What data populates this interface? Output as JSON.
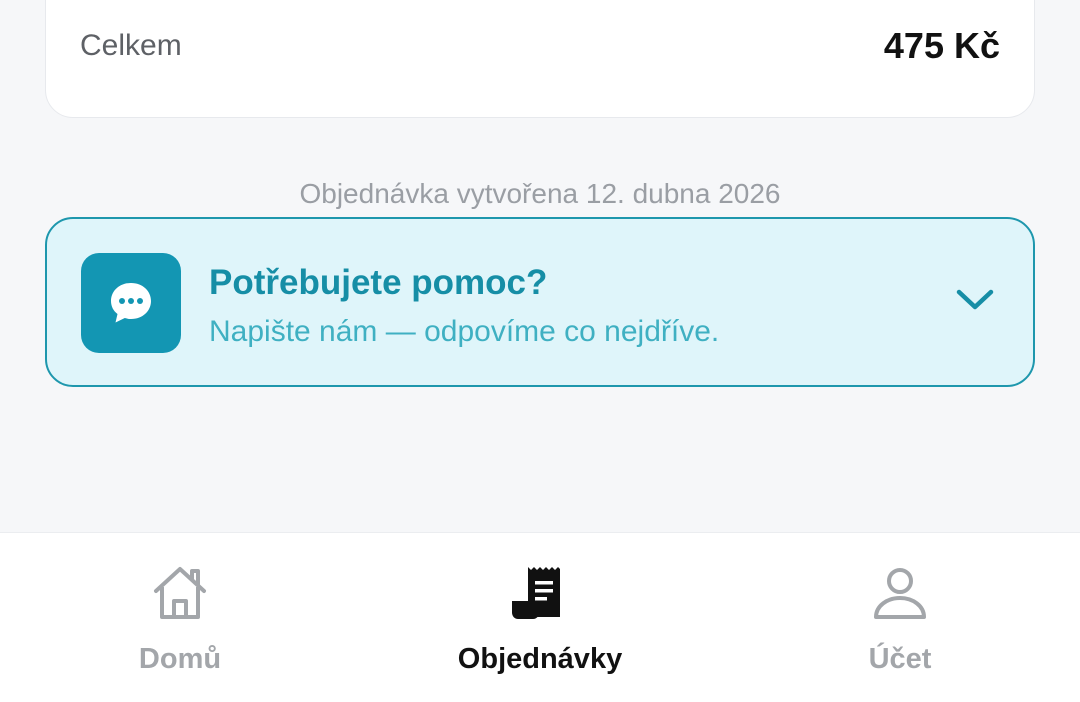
{
  "summary": {
    "total_label": "Celkem",
    "total_value": "475 Kč"
  },
  "order": {
    "created_text": "Objednávka vytvořena 12. dubna 2026"
  },
  "help": {
    "title": "Potřebujete pomoc?",
    "subtitle": "Napište nám — odpovíme co nejdříve.",
    "icon": "chat-bubble-icon",
    "expand_icon": "chevron-down-icon",
    "accent_color": "#1396b3",
    "background_color": "#dff5fa"
  },
  "nav": {
    "items": [
      {
        "label": "Domů",
        "icon": "home-icon",
        "active": false
      },
      {
        "label": "Objednávky",
        "icon": "receipt-icon",
        "active": true
      },
      {
        "label": "Účet",
        "icon": "user-icon",
        "active": false
      }
    ]
  }
}
